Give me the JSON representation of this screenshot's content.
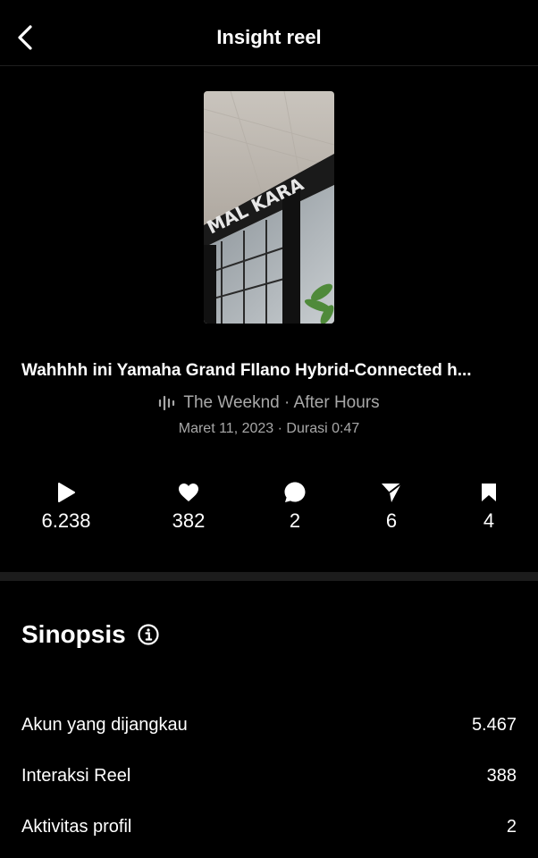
{
  "header": {
    "title": "Insight reel"
  },
  "reel": {
    "caption": "Wahhhh ini Yamaha Grand FIlano Hybrid-Connected h...",
    "audio": "The Weeknd · After Hours",
    "date": "Maret 11, 2023",
    "separator": "·",
    "duration": "Durasi 0:47"
  },
  "stats": [
    {
      "icon": "play-icon",
      "value": "6.238"
    },
    {
      "icon": "heart-icon",
      "value": "382"
    },
    {
      "icon": "comment-icon",
      "value": "2"
    },
    {
      "icon": "send-icon",
      "value": "6"
    },
    {
      "icon": "bookmark-icon",
      "value": "4"
    }
  ],
  "overview": {
    "title": "Sinopsis",
    "rows": [
      {
        "label": "Akun yang dijangkau",
        "value": "5.467"
      },
      {
        "label": "Interaksi Reel",
        "value": "388"
      },
      {
        "label": "Aktivitas profil",
        "value": "2"
      }
    ]
  },
  "colors": {
    "background": "#000000",
    "text": "#ffffff",
    "secondary_text": "#a8a8a8",
    "divider": "#1c1c1c"
  }
}
